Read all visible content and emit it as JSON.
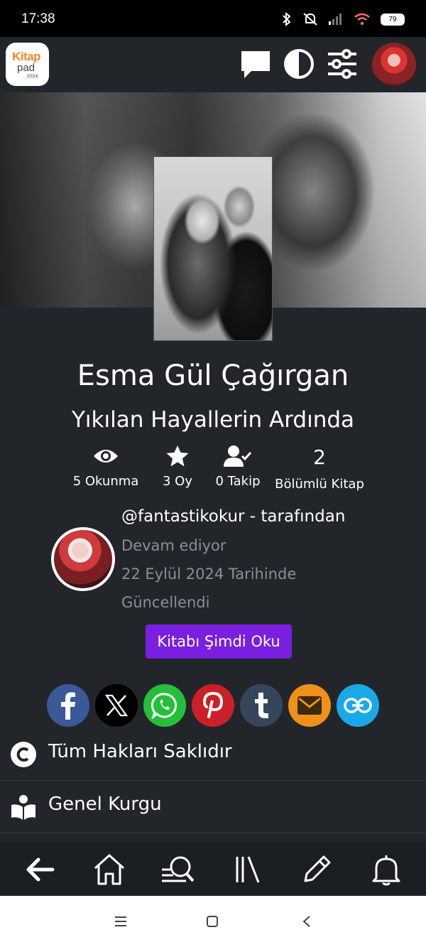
{
  "status_bar": {
    "time": "17:38",
    "battery": "79"
  },
  "header": {
    "logo_top": "Kitap",
    "logo_bottom": "pad",
    "logo_tag": "2024"
  },
  "book": {
    "author_name": "Esma Gül Çağırgan",
    "title": "Yıkılan Hayallerin Ardında",
    "stats": {
      "reads": "5 Okunma",
      "votes": "3 Oy",
      "followers": "0 Takip",
      "chapter_count": "2",
      "chapter_label": "Bölümlü Kitap"
    },
    "byline": "@fantastikokur - tarafından",
    "status": "Devam ediyor",
    "updated_line1": "22 Eylül 2024 Tarihinde",
    "updated_line2": "Güncellendi",
    "read_button": "Kitabı Şimdi Oku"
  },
  "share_colors": {
    "facebook": "#3b5998",
    "x": "#000000",
    "whatsapp": "#25c03a",
    "pinterest": "#cb2027",
    "tumblr": "#35465c",
    "email": "#f0901a",
    "link": "#1aa9e8"
  },
  "info_rows": [
    {
      "label": "Tüm Hakları Saklıdır",
      "icon": "copyright-icon"
    },
    {
      "label": "Genel Kurgu",
      "icon": "reader-icon"
    }
  ],
  "accent": "#7a1fe0"
}
